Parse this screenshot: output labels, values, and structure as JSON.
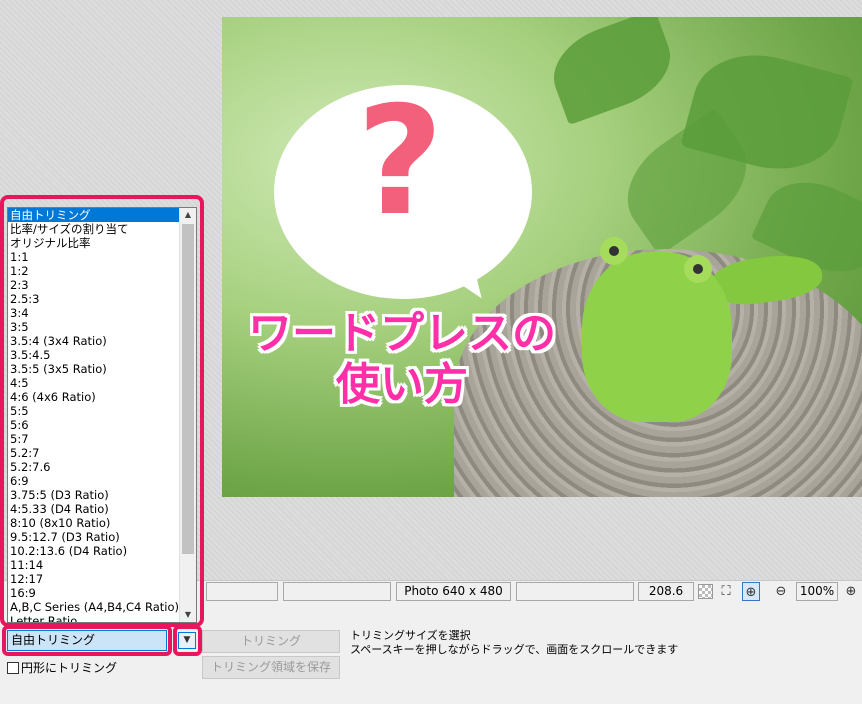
{
  "image": {
    "bubble_symbol": "?",
    "caption_line1": "ワードプレスの",
    "caption_line2": "使い方"
  },
  "statusbar": {
    "dimensions": "Photo 640 x 480",
    "filesize": "208.6 KB",
    "zoom": "100%",
    "icons": [
      "transparency-checker-icon",
      "fit-window-icon",
      "actual-size-icon",
      "zoom-out-icon",
      "zoom-in-icon"
    ]
  },
  "trim": {
    "mode_selected": "自由トリミング",
    "options": [
      "自由トリミング",
      "比率/サイズの割り当て",
      "オリジナル比率",
      "1:1",
      "1:2",
      "2:3",
      "2.5:3",
      "3:4",
      "3:5",
      "3.5:4 (3x4 Ratio)",
      "3.5:4.5",
      "3.5:5 (3x5 Ratio)",
      "4:5",
      "4:6 (4x6 Ratio)",
      "5:5",
      "5:6",
      "5:7",
      "5.2:7",
      "5.2:7.6",
      "6:9",
      "3.75:5 (D3 Ratio)",
      "4:5.33 (D4 Ratio)",
      "8:10 (8x10 Ratio)",
      "9.5:12.7 (D3 Ratio)",
      "10.2:13.6 (D4 Ratio)",
      "11:14",
      "12:17",
      "16:9",
      "A,B,C Series (A4,B4,C4 Ratio)",
      "Letter Ratio"
    ],
    "circle_label": "円形にトリミング",
    "trim_button": "トリミング",
    "save_area_button": "トリミング領域を保存",
    "hint_line1": "トリミングサイズを選択",
    "hint_line2": "スペースキーを押しながらドラッグで、画面をスクロールできます"
  },
  "colors": {
    "highlight": "#e8175d",
    "selection": "#0078d7",
    "caption": "#ff2fa8",
    "question_mark": "#f2607c"
  }
}
